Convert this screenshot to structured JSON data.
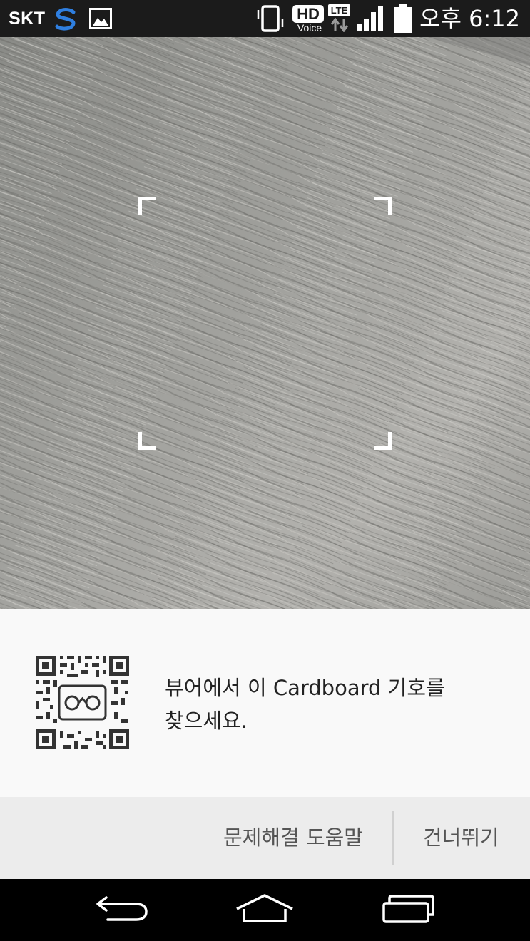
{
  "status_bar": {
    "carrier": "SKT",
    "clock": "오후 6:12",
    "icons": [
      "s-app-icon",
      "gallery-icon",
      "vibrate-icon",
      "hd-voice-icon",
      "lte-icon",
      "signal-icon",
      "battery-icon"
    ],
    "hd_label": "HD",
    "voice_label": "Voice",
    "lte_label": "LTE"
  },
  "camera": {
    "description_colors": {
      "base": "#8e8f8b",
      "light": "#b7b6b1",
      "dark": "#6f6f6c"
    }
  },
  "instruction": {
    "line1": "뷰어에서 이 Cardboard 기호를",
    "line2": "찾으세요."
  },
  "actions": {
    "help_label": "문제해결 도움말",
    "skip_label": "건너뛰기"
  },
  "nav": {
    "icons": [
      "back-icon",
      "home-icon",
      "recent-apps-icon"
    ]
  },
  "colors": {
    "status_bar_bg": "#1b1b1b",
    "panel_bg": "#f9f9f9",
    "action_bar_bg": "#ececec",
    "nav_bar_bg": "#000000",
    "s_icon_blue": "#2f7fe0"
  }
}
